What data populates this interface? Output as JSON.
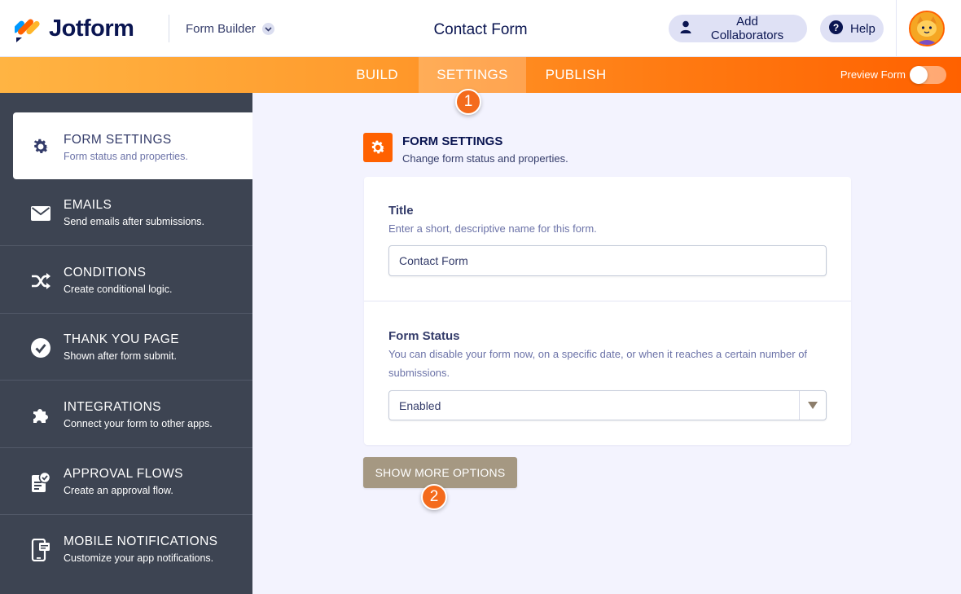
{
  "header": {
    "logo_text": "Jotform",
    "builder_label": "Form Builder",
    "form_title": "Contact Form",
    "add_collaborators_label": "Add Collaborators",
    "help_label": "Help"
  },
  "nav": {
    "tabs": [
      {
        "label": "BUILD",
        "active": false
      },
      {
        "label": "SETTINGS",
        "active": true
      },
      {
        "label": "PUBLISH",
        "active": false
      }
    ],
    "preview_label": "Preview Form",
    "preview_enabled": false
  },
  "steps": {
    "one": "1",
    "two": "2"
  },
  "sidebar": {
    "items": [
      {
        "title": "FORM SETTINGS",
        "desc": "Form status and properties.",
        "icon": "gear-icon",
        "active": true
      },
      {
        "title": "EMAILS",
        "desc": "Send emails after submissions.",
        "icon": "envelope-icon"
      },
      {
        "title": "CONDITIONS",
        "desc": "Create conditional logic.",
        "icon": "shuffle-icon"
      },
      {
        "title": "THANK YOU PAGE",
        "desc": "Shown after form submit.",
        "icon": "check-circle-icon"
      },
      {
        "title": "INTEGRATIONS",
        "desc": "Connect your form to other apps.",
        "icon": "puzzle-icon"
      },
      {
        "title": "APPROVAL FLOWS",
        "desc": "Create an approval flow.",
        "icon": "approval-icon"
      },
      {
        "title": "MOBILE NOTIFICATIONS",
        "desc": "Customize your app notifications.",
        "icon": "mobile-icon"
      }
    ]
  },
  "main": {
    "section_title": "FORM SETTINGS",
    "section_subtitle": "Change form status and properties.",
    "title_field": {
      "label": "Title",
      "help": "Enter a short, descriptive name for this form.",
      "value": "Contact Form"
    },
    "status_field": {
      "label": "Form Status",
      "help": "You can disable your form now, on a specific date, or when it reaches a certain number of submissions.",
      "value": "Enabled"
    },
    "more_options_label": "SHOW MORE OPTIONS"
  },
  "colors": {
    "accent_orange": "#ff6100",
    "sidebar_bg": "#3d4452",
    "navy_text": "#0a1551",
    "more_button": "#a59882"
  }
}
